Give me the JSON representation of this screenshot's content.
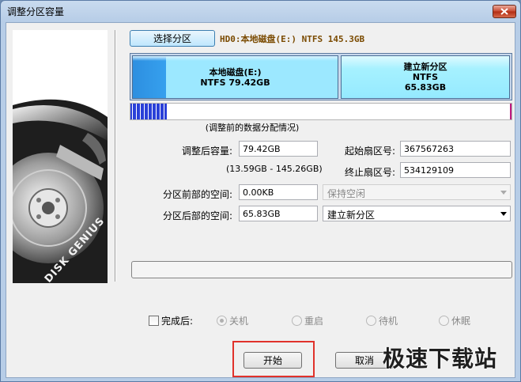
{
  "window": {
    "title": "调整分区容量"
  },
  "brand": {
    "side_text": "DISK GENIUS"
  },
  "toolbar": {
    "select_partition_label": "选择分区"
  },
  "disk_info": "HD0:本地磁盘(E:) NTFS 145.3GB",
  "partition_map": {
    "left": {
      "name": "本地磁盘(E:)",
      "detail": "NTFS 79.42GB",
      "used_fraction": 0.16
    },
    "right": {
      "name": "建立新分区",
      "fs": "NTFS",
      "size": "65.83GB"
    }
  },
  "map_caption": "(调整前的数据分配情况)",
  "form": {
    "size_after_label": "调整后容量:",
    "size_after_value": "79.42GB",
    "size_range": "(13.59GB - 145.26GB)",
    "start_sector_label": "起始扇区号:",
    "start_sector_value": "367567263",
    "end_sector_label": "终止扇区号:",
    "end_sector_value": "534129109",
    "space_before_label": "分区前部的空间:",
    "space_before_value": "0.00KB",
    "space_before_action": "保持空闲",
    "space_after_label": "分区后部的空间:",
    "space_after_value": "65.83GB",
    "space_after_action": "建立新分区"
  },
  "on_complete": {
    "label": "完成后:",
    "options": [
      "关机",
      "重启",
      "待机",
      "休眠"
    ]
  },
  "buttons": {
    "start": "开始",
    "cancel": "取消"
  },
  "watermark": "极速下载站",
  "colors": {
    "partition_used": "#2d8fe0",
    "partition_free": "#9ce8ff",
    "highlight": "#e0322b",
    "usage_bar": "#2a40d8"
  }
}
